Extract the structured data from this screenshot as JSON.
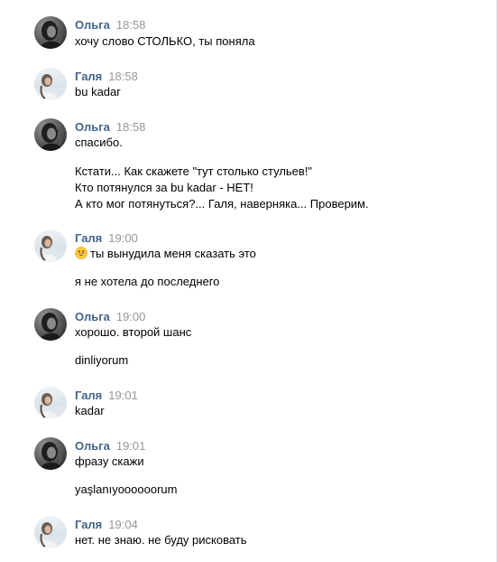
{
  "chat": {
    "messages": [
      {
        "author": "Ольга",
        "time": "18:58",
        "avatar": "olga-avatar",
        "lines": [
          "хочу слово СТОЛЬКО, ты поняла"
        ]
      },
      {
        "author": "Галя",
        "time": "18:58",
        "avatar": "galya-avatar",
        "lines": [
          "bu kadar"
        ]
      },
      {
        "author": "Ольга",
        "time": "18:58",
        "avatar": "olga-avatar",
        "lines": [
          "спасибо.",
          "Кстати... Как скажете \"тут столько стульев!\"",
          "Кто потянулся за bu kadar - НЕТ!",
          "А кто мог потянуться?... Галя, наверняка... Проверим."
        ]
      },
      {
        "author": "Галя",
        "time": "19:00",
        "avatar": "galya-avatar",
        "emoji": "grinning-face-emoji",
        "lines": [
          "ты вынудила меня сказать это",
          "я не хотела до последнего"
        ]
      },
      {
        "author": "Ольга",
        "time": "19:00",
        "avatar": "olga-avatar",
        "lines": [
          "хорошо. второй шанс",
          "dinliyorum"
        ]
      },
      {
        "author": "Галя",
        "time": "19:01",
        "avatar": "galya-avatar",
        "lines": [
          "kadar"
        ]
      },
      {
        "author": "Ольга",
        "time": "19:01",
        "avatar": "olga-avatar",
        "lines": [
          "фразу скажи",
          "yaşlanıyoooooorum"
        ]
      },
      {
        "author": "Галя",
        "time": "19:04",
        "avatar": "galya-avatar",
        "lines": [
          "нет. не знаю. не буду рисковать"
        ]
      }
    ]
  },
  "colors": {
    "author": "#42648b",
    "time": "#939699",
    "text": "#000000",
    "background": "#ffffff"
  }
}
